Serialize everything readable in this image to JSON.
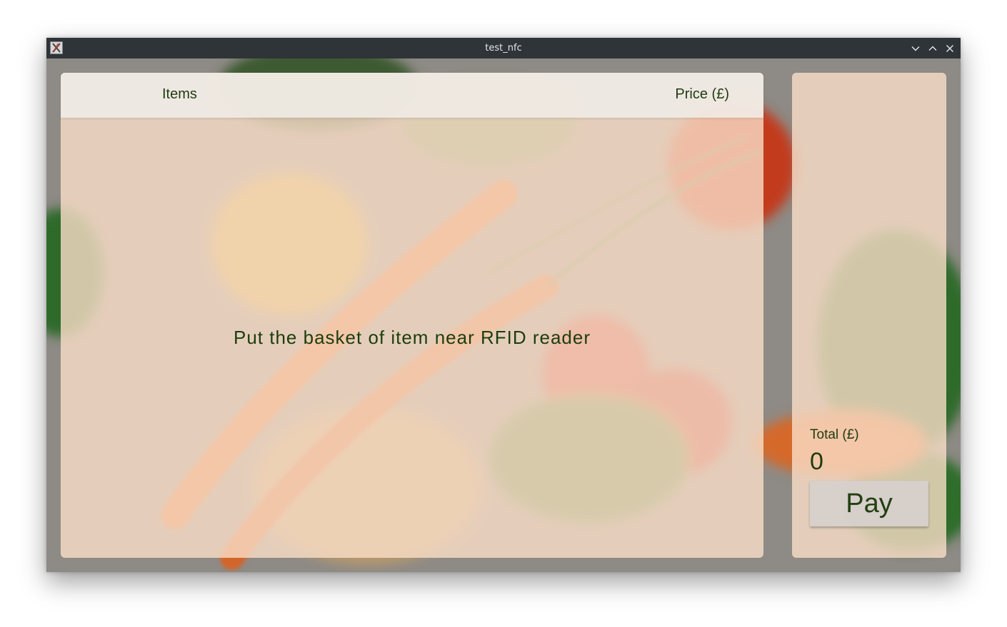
{
  "window": {
    "title": "test_nfc",
    "icons": {
      "app": "x-window-icon",
      "minimize": "chevron-down-icon",
      "maximize": "chevron-up-icon",
      "close": "close-icon"
    }
  },
  "items_table": {
    "columns": [
      "Items",
      "Price (£)"
    ],
    "rows": [],
    "empty_message": "Put the basket of item near RFID reader"
  },
  "summary": {
    "total_label": "Total (£)",
    "total_value": "0",
    "pay_label": "Pay"
  },
  "colors": {
    "text": "#1f3b10",
    "panel": "#fadec8",
    "titlebar": "#2f3438"
  }
}
